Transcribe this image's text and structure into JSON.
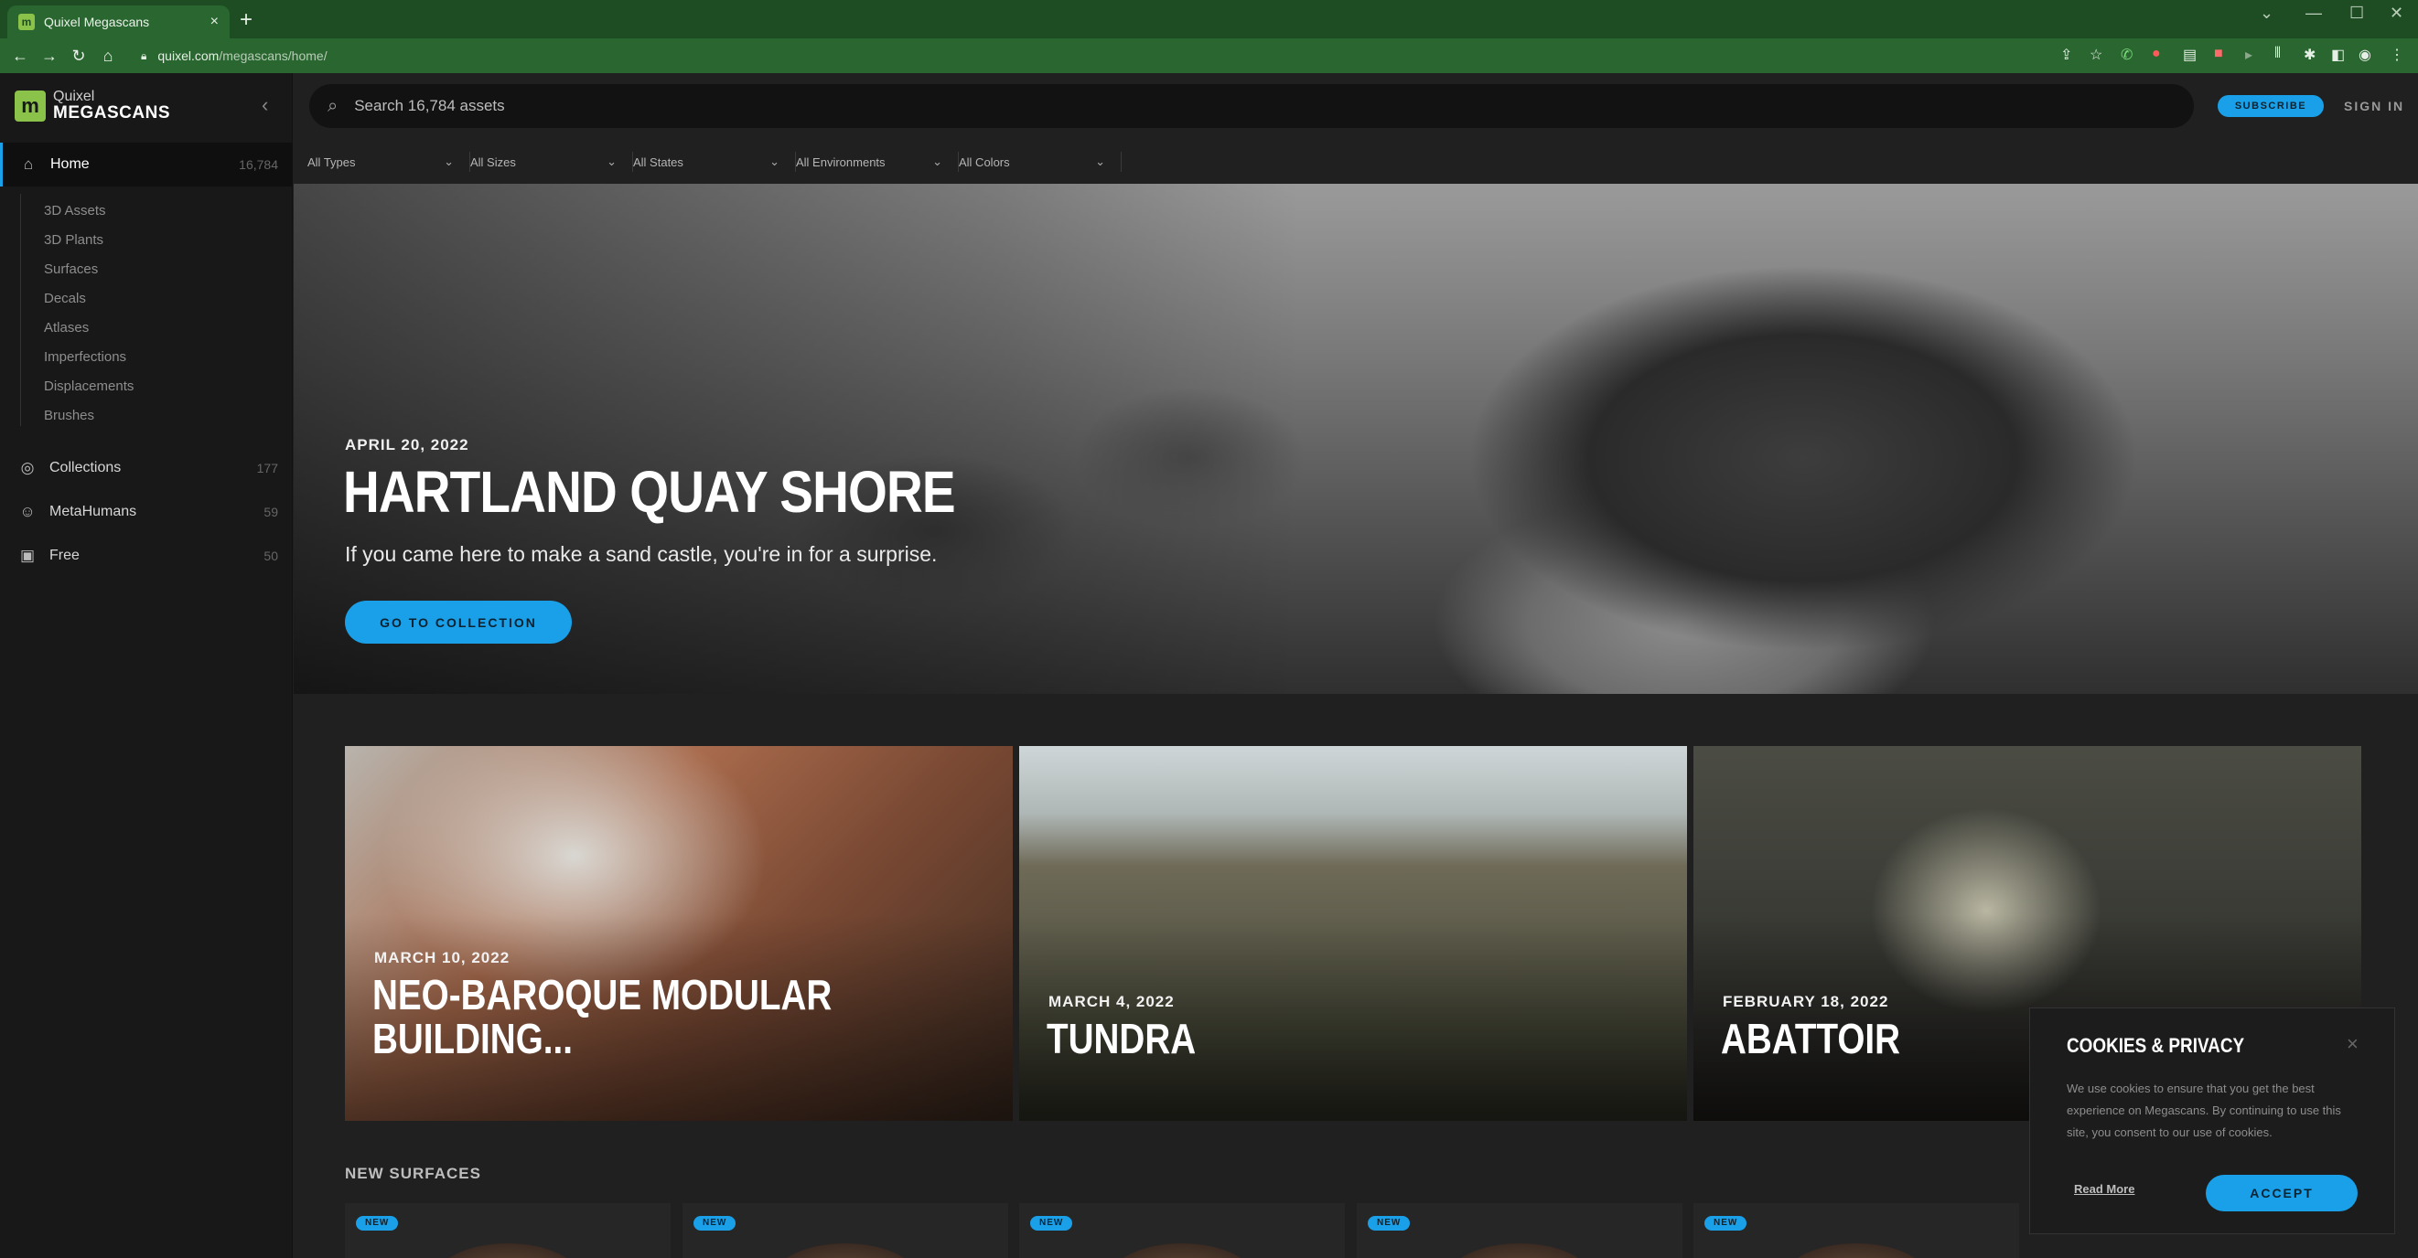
{
  "browser": {
    "tab_title": "Quixel Megascans",
    "new_tab": "+",
    "close_tab": "×",
    "url_host": "quixel.com",
    "url_path": "/megascans/home/"
  },
  "brand": {
    "line1": "Quixel",
    "line2": "MEGASCANS",
    "logo_glyph": "m"
  },
  "sidebar": {
    "home": {
      "label": "Home",
      "count": "16,784"
    },
    "sub_items": [
      "3D Assets",
      "3D Plants",
      "Surfaces",
      "Decals",
      "Atlases",
      "Imperfections",
      "Displacements",
      "Brushes"
    ],
    "items": [
      {
        "label": "Collections",
        "count": "177",
        "icon": "globe-icon"
      },
      {
        "label": "MetaHumans",
        "count": "59",
        "icon": "user-circle-icon"
      },
      {
        "label": "Free",
        "count": "50",
        "icon": "gift-icon"
      }
    ]
  },
  "search": {
    "placeholder": "Search 16,784 assets"
  },
  "header": {
    "subscribe": "SUBSCRIBE",
    "signin": "SIGN IN"
  },
  "filters": [
    "All Types",
    "All Sizes",
    "All States",
    "All Environments",
    "All Colors"
  ],
  "hero": {
    "date": "APRIL 20, 2022",
    "title": "HARTLAND QUAY SHORE",
    "subtitle": "If you came here to make a sand castle, you're in for a surprise.",
    "button": "GO TO COLLECTION"
  },
  "featured": [
    {
      "date": "MARCH 10, 2022",
      "title_line1": "NEO-BAROQUE MODULAR",
      "title_line2": "BUILDING..."
    },
    {
      "date": "MARCH 4, 2022",
      "title_line1": "TUNDRA"
    },
    {
      "date": "FEBRUARY 18, 2022",
      "title_line1": "ABATTOIR"
    }
  ],
  "new_surfaces": {
    "title": "NEW SURFACES",
    "badge": "NEW"
  },
  "cookie": {
    "title": "COOKIES & PRIVACY",
    "body": "We use cookies to ensure that you get the best experience on Megascans. By continuing to use this site, you consent to our use of cookies.",
    "read_more": "Read More",
    "accept": "ACCEPT",
    "close": "×"
  },
  "colors": {
    "accent": "#1aa0e8",
    "chrome": "#2a6630",
    "sidebar": "#181818"
  }
}
